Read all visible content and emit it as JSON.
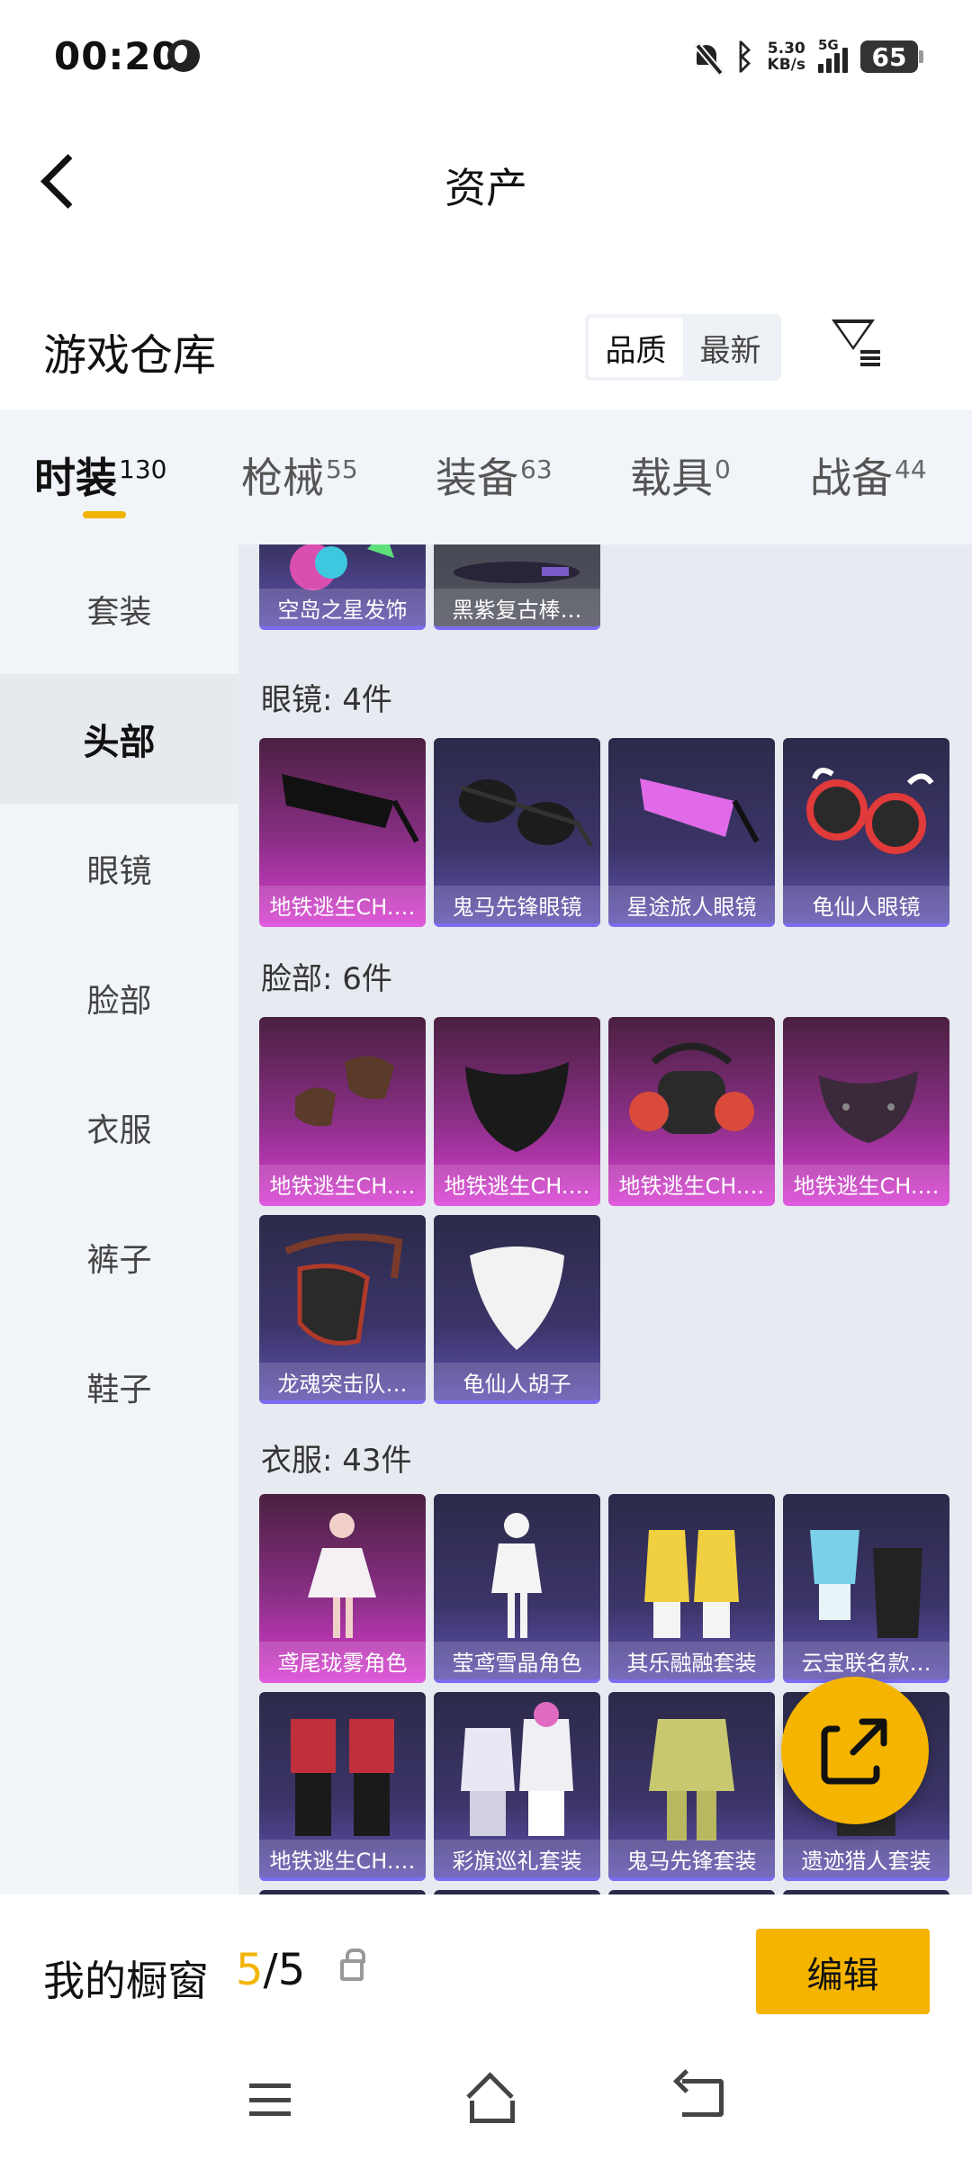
{
  "status_bar": {
    "time": "00:20",
    "net_speed_value": "5.30",
    "net_speed_unit": "KB/s",
    "signal_type": "5G",
    "battery": "65"
  },
  "header": {
    "title": "资产"
  },
  "warehouse": {
    "title": "游戏仓库",
    "sort_quality": "品质",
    "sort_latest": "最新"
  },
  "tabs": [
    {
      "label": "时装",
      "count": "130"
    },
    {
      "label": "枪械",
      "count": "55"
    },
    {
      "label": "装备",
      "count": "63"
    },
    {
      "label": "载具",
      "count": "0"
    },
    {
      "label": "战备",
      "count": "44"
    }
  ],
  "sidebar": {
    "items": [
      "套装",
      "头部",
      "眼镜",
      "脸部",
      "衣服",
      "裤子",
      "鞋子"
    ]
  },
  "sections": {
    "top_partial": [
      "空岛之星发饰",
      "黑紫复古棒…"
    ],
    "glasses": {
      "title": "眼镜: 4件",
      "items": [
        "地铁逃生CH.…",
        "鬼马先锋眼镜",
        "星途旅人眼镜",
        "龟仙人眼镜"
      ]
    },
    "face": {
      "title": "脸部: 6件",
      "items": [
        "地铁逃生CH.…",
        "地铁逃生CH.…",
        "地铁逃生CH.…",
        "地铁逃生CH.…",
        "龙魂突击队…",
        "龟仙人胡子"
      ]
    },
    "clothes": {
      "title": "衣服: 43件",
      "items": [
        "鸢尾珑雾角色",
        "莹鸢雪晶角色",
        "其乐融融套装",
        "云宝联名款…",
        "地铁逃生CH.…",
        "彩旗巡礼套装",
        "鬼马先锋套装",
        "遗迹猎人套装"
      ]
    }
  },
  "showcase": {
    "label": "我的橱窗",
    "current": "5",
    "separator": "/",
    "total": "5",
    "edit_label": "编辑"
  },
  "colors": {
    "accent": "#f5b400",
    "mythic_card": "#d63ccf",
    "standard_card": "#3b3568"
  }
}
